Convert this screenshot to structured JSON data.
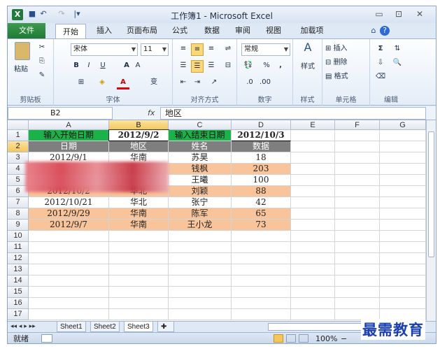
{
  "window": {
    "title": "工作簿1 - Microsoft Excel",
    "logo": "X"
  },
  "quick_access": [
    {
      "icon": "save-icon",
      "glyph": "■"
    },
    {
      "icon": "undo-icon",
      "glyph": "↶"
    },
    {
      "icon": "redo-icon",
      "glyph": "↷"
    },
    {
      "icon": "customize-icon",
      "glyph": "|▾"
    }
  ],
  "window_controls": [
    {
      "icon": "minimize-icon",
      "glyph": "▭"
    },
    {
      "icon": "restore-icon",
      "glyph": "⊡"
    },
    {
      "icon": "close-icon",
      "glyph": "✕"
    }
  ],
  "tabs": [
    "文件",
    "开始",
    "插入",
    "页面布局",
    "公式",
    "数据",
    "审阅",
    "视图",
    "加载项"
  ],
  "active_tab": "开始",
  "ribbon": {
    "clipboard": {
      "label": "剪贴板",
      "paste": "粘贴"
    },
    "font": {
      "label": "字体",
      "name": "宋体",
      "size": "11",
      "bold": "B",
      "italic": "I",
      "underline": "U",
      "grow": "A",
      "shrink": "A",
      "wen": "变"
    },
    "alignment": {
      "label": "对齐方式"
    },
    "number": {
      "label": "数字",
      "format": "常规",
      "percent": "%",
      "comma": ","
    },
    "styles": {
      "label": "样式",
      "name": "样式"
    },
    "cells": {
      "label": "单元格",
      "insert": "插入",
      "delete": "删除",
      "format": "格式"
    },
    "editing": {
      "label": "编辑",
      "sum": "Σ"
    }
  },
  "formula_bar": {
    "name_box": "B2",
    "fx": "fx",
    "content": "地区"
  },
  "columns": [
    "A",
    "B",
    "C",
    "D",
    "E",
    "F",
    "G"
  ],
  "selected_column": "B",
  "selected_row": "2",
  "rows": [
    "1",
    "2",
    "3",
    "4",
    "5",
    "6",
    "7",
    "8",
    "9",
    "10",
    "11",
    "12",
    "13",
    "14",
    "15",
    "16",
    "17"
  ],
  "cells": {
    "r1": [
      "输入开始日期",
      "2012/9/2",
      "输入结束日期",
      "2012/10/3"
    ],
    "r2": [
      "日期",
      "地区",
      "姓名",
      "数据"
    ],
    "r3": [
      "2012/9/1",
      "华南",
      "苏昊",
      "18"
    ],
    "r4": [
      "",
      "",
      "钱枫",
      "203"
    ],
    "r5": [
      "",
      "",
      "王曦",
      "100"
    ],
    "r6": [
      "2012/10/2",
      "华北",
      "刘颖",
      "88"
    ],
    "r7": [
      "2012/10/21",
      "华北",
      "张宁",
      "42"
    ],
    "r8": [
      "2012/9/29",
      "华南",
      "陈军",
      "65"
    ],
    "r9": [
      "2012/9/7",
      "华南",
      "王小龙",
      "73"
    ]
  },
  "colors": {
    "green": "#19b34a",
    "gray_header": "#7f7f7f",
    "orange_row": "#f9c49a",
    "selection": "#f5c75b"
  },
  "sheets": [
    "Sheet1",
    "Sheet2",
    "Sheet3"
  ],
  "active_sheet": "Sheet3",
  "status": {
    "mode": "就绪",
    "zoom": "100%",
    "minus": "−"
  },
  "watermark": "最需教育"
}
